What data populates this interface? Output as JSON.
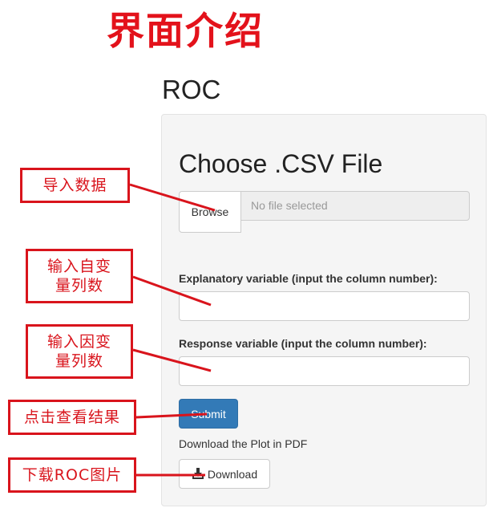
{
  "page": {
    "heading": "界面介绍",
    "title": "ROC"
  },
  "form": {
    "file_heading": "Choose .CSV File",
    "browse_label": "Browse",
    "file_placeholder": "No file selected",
    "explanatory_label": "Explanatory variable (input the column number):",
    "explanatory_value": "",
    "response_label": "Response variable (input the column number):",
    "response_value": "",
    "submit_label": "Submit",
    "download_caption": "Download the Plot in PDF",
    "download_label": "Download",
    "download_icon": "download-icon"
  },
  "annotations": [
    {
      "text": "导入数据"
    },
    {
      "text": "输入自变\n量列数"
    },
    {
      "text": "输入因变\n量列数"
    },
    {
      "text": "点击查看结果"
    },
    {
      "text": "下载ROC图片"
    }
  ],
  "colors": {
    "heading": "#e3121b",
    "callout": "#d9141c",
    "primary": "#337ab7",
    "panel": "#f5f5f5"
  }
}
